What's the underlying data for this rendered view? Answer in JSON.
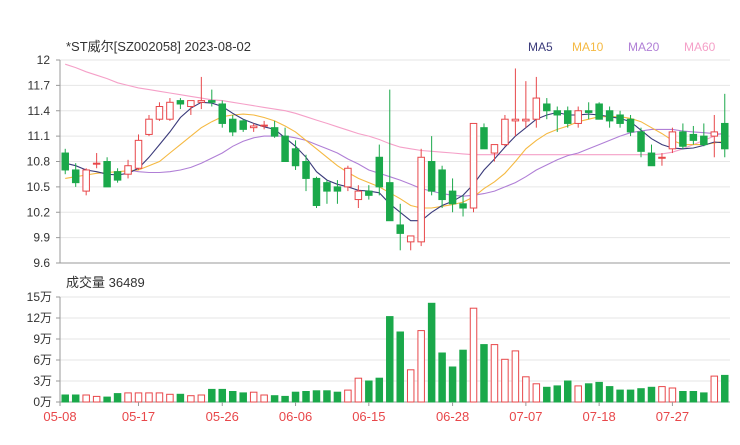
{
  "title": "*ST威尔[SZ002058] 2023-08-02",
  "legend": [
    {
      "label": "MA5",
      "color": "#3a3a7a"
    },
    {
      "label": "MA10",
      "color": "#f5b942"
    },
    {
      "label": "MA20",
      "color": "#b07fd6"
    },
    {
      "label": "MA60",
      "color": "#f5a0c8"
    }
  ],
  "colors": {
    "up": "#e8474a",
    "down": "#1aa84a",
    "grid": "#e6e6e6",
    "axis": "#999999",
    "text": "#333333",
    "date": "#e8474a"
  },
  "volume_label": "成交量 36489",
  "chart_data": [
    {
      "type": "candlestick",
      "ylim": [
        9.6,
        12.0
      ],
      "yticks": [
        "12",
        "11.7",
        "11.4",
        "11.1",
        "10.8",
        "10.5",
        "10.2",
        "9.9",
        "9.6"
      ],
      "ytick_values": [
        12.0,
        11.7,
        11.4,
        11.1,
        10.8,
        10.5,
        10.2,
        9.9,
        9.6
      ],
      "ohlc": [
        [
          10.9,
          10.95,
          10.65,
          10.7
        ],
        [
          10.7,
          10.78,
          10.5,
          10.55
        ],
        [
          10.45,
          10.72,
          10.4,
          10.7
        ],
        [
          10.78,
          10.9,
          10.72,
          10.78
        ],
        [
          10.8,
          10.85,
          10.5,
          10.5
        ],
        [
          10.68,
          10.72,
          10.55,
          10.58
        ],
        [
          10.65,
          10.82,
          10.6,
          10.75
        ],
        [
          10.72,
          11.12,
          10.7,
          11.05
        ],
        [
          11.12,
          11.35,
          11.1,
          11.3
        ],
        [
          11.3,
          11.5,
          11.28,
          11.45
        ],
        [
          11.3,
          11.55,
          11.28,
          11.5
        ],
        [
          11.52,
          11.55,
          11.42,
          11.48
        ],
        [
          11.45,
          11.5,
          11.35,
          11.52
        ],
        [
          11.5,
          11.8,
          11.42,
          11.52
        ],
        [
          11.52,
          11.65,
          11.45,
          11.5
        ],
        [
          11.48,
          11.52,
          11.2,
          11.25
        ],
        [
          11.3,
          11.35,
          11.1,
          11.15
        ],
        [
          11.28,
          11.3,
          11.15,
          11.18
        ],
        [
          11.2,
          11.25,
          11.15,
          11.22
        ],
        [
          11.22,
          11.28,
          11.18,
          11.23
        ],
        [
          11.2,
          11.28,
          11.08,
          11.1
        ],
        [
          11.1,
          11.2,
          10.85,
          10.8
        ],
        [
          10.95,
          11.05,
          10.7,
          10.75
        ],
        [
          10.8,
          10.88,
          10.45,
          10.6
        ],
        [
          10.6,
          10.62,
          10.25,
          10.28
        ],
        [
          10.55,
          10.58,
          10.3,
          10.45
        ],
        [
          10.5,
          10.58,
          10.3,
          10.45
        ],
        [
          10.5,
          10.75,
          10.45,
          10.72
        ],
        [
          10.35,
          10.52,
          10.25,
          10.45
        ],
        [
          10.45,
          10.52,
          10.35,
          10.4
        ],
        [
          10.85,
          11.0,
          10.4,
          10.5
        ],
        [
          10.55,
          11.65,
          10.5,
          10.1
        ],
        [
          10.05,
          10.3,
          9.75,
          9.95
        ],
        [
          9.85,
          9.92,
          9.75,
          9.92
        ],
        [
          9.85,
          10.95,
          9.8,
          10.85
        ],
        [
          10.8,
          11.1,
          10.4,
          10.45
        ],
        [
          10.7,
          10.75,
          10.25,
          10.35
        ],
        [
          10.45,
          10.6,
          10.2,
          10.3
        ],
        [
          10.3,
          10.4,
          10.15,
          10.25
        ],
        [
          10.25,
          11.25,
          10.2,
          11.25
        ],
        [
          11.2,
          11.25,
          10.95,
          10.95
        ],
        [
          10.9,
          11.0,
          10.8,
          11.0
        ],
        [
          11.0,
          11.35,
          10.98,
          11.3
        ],
        [
          11.28,
          11.9,
          11.1,
          11.3
        ],
        [
          11.28,
          11.75,
          11.2,
          11.3
        ],
        [
          11.3,
          11.8,
          11.2,
          11.55
        ],
        [
          11.48,
          11.55,
          11.3,
          11.4
        ],
        [
          11.4,
          11.45,
          11.15,
          11.35
        ],
        [
          11.4,
          11.45,
          11.2,
          11.25
        ],
        [
          11.25,
          11.45,
          11.2,
          11.4
        ],
        [
          11.4,
          11.5,
          11.3,
          11.38
        ],
        [
          11.48,
          11.5,
          11.3,
          11.3
        ],
        [
          11.4,
          11.45,
          11.2,
          11.28
        ],
        [
          11.35,
          11.4,
          11.2,
          11.25
        ],
        [
          11.3,
          11.35,
          11.1,
          11.15
        ],
        [
          11.15,
          11.2,
          10.85,
          10.92
        ],
        [
          10.9,
          11.0,
          10.75,
          10.75
        ],
        [
          10.85,
          10.9,
          10.75,
          10.85
        ],
        [
          10.95,
          11.2,
          10.9,
          11.15
        ],
        [
          11.15,
          11.25,
          10.95,
          10.98
        ],
        [
          11.12,
          11.22,
          11.0,
          11.05
        ],
        [
          11.1,
          11.25,
          10.98,
          11.0
        ],
        [
          11.1,
          11.35,
          10.85,
          11.15
        ],
        [
          11.25,
          11.6,
          10.85,
          10.95
        ]
      ],
      "ma5": [
        10.78,
        10.75,
        10.7,
        10.68,
        10.65,
        10.64,
        10.66,
        10.72,
        10.85,
        11.0,
        11.15,
        11.32,
        11.43,
        11.5,
        11.49,
        11.45,
        11.37,
        11.3,
        11.25,
        11.21,
        11.18,
        11.08,
        10.98,
        10.85,
        10.68,
        10.58,
        10.53,
        10.5,
        10.46,
        10.45,
        10.43,
        10.3,
        10.2,
        10.1,
        10.1,
        10.2,
        10.28,
        10.33,
        10.4,
        10.53,
        10.7,
        10.83,
        10.97,
        11.1,
        11.2,
        11.3,
        11.35,
        11.38,
        11.35,
        11.35,
        11.36,
        11.35,
        11.33,
        11.31,
        11.27,
        11.17,
        11.07,
        11.0,
        10.96,
        10.95,
        10.96,
        10.99,
        11.03,
        11.02
      ],
      "ma10": [
        10.6,
        10.62,
        10.64,
        10.66,
        10.67,
        10.68,
        10.69,
        10.7,
        10.75,
        10.8,
        10.9,
        11.0,
        11.1,
        11.2,
        11.27,
        11.33,
        11.35,
        11.36,
        11.35,
        11.32,
        11.28,
        11.22,
        11.15,
        11.05,
        10.95,
        10.85,
        10.75,
        10.67,
        10.6,
        10.55,
        10.5,
        10.43,
        10.36,
        10.28,
        10.25,
        10.25,
        10.27,
        10.29,
        10.32,
        10.38,
        10.48,
        10.56,
        10.66,
        10.8,
        10.95,
        11.05,
        11.13,
        11.18,
        11.22,
        11.27,
        11.3,
        11.33,
        11.33,
        11.33,
        11.31,
        11.27,
        11.2,
        11.13,
        11.05,
        11.0,
        11.0,
        11.0,
        11.02,
        11.04
      ],
      "ma20": [
        null,
        null,
        null,
        null,
        null,
        null,
        10.7,
        10.68,
        10.67,
        10.67,
        10.68,
        10.7,
        10.73,
        10.78,
        10.84,
        10.9,
        10.98,
        11.04,
        11.08,
        11.1,
        11.1,
        11.1,
        11.08,
        11.05,
        11.0,
        10.95,
        10.9,
        10.83,
        10.77,
        10.7,
        10.66,
        10.62,
        10.58,
        10.53,
        10.48,
        10.45,
        10.42,
        10.4,
        10.39,
        10.4,
        10.42,
        10.45,
        10.5,
        10.55,
        10.62,
        10.7,
        10.76,
        10.82,
        10.87,
        10.9,
        10.95,
        11.0,
        11.05,
        11.1,
        11.14,
        11.16,
        11.18,
        11.18,
        11.18,
        11.16,
        11.15,
        11.14,
        11.13,
        11.12
      ],
      "ma60": [
        11.95,
        11.91,
        11.86,
        11.82,
        11.78,
        11.73,
        11.7,
        11.67,
        11.65,
        11.63,
        11.61,
        11.59,
        11.57,
        11.55,
        11.53,
        11.52,
        11.5,
        11.48,
        11.46,
        11.44,
        11.42,
        11.4,
        11.37,
        11.33,
        11.29,
        11.25,
        11.21,
        11.17,
        11.13,
        11.1,
        11.06,
        11.01,
        10.97,
        10.95,
        10.93,
        10.92,
        10.91,
        10.9,
        10.89,
        10.88,
        10.88,
        10.88,
        10.88,
        10.88,
        10.88,
        10.88,
        10.88,
        10.88,
        10.88,
        10.88,
        10.88,
        10.88,
        10.88,
        10.88,
        10.88,
        10.88,
        10.88,
        10.89,
        10.91,
        10.95,
        11.0,
        11.05,
        11.1,
        11.15
      ]
    },
    {
      "type": "bar",
      "ylim": [
        0,
        15
      ],
      "yticks": [
        "15万",
        "12万",
        "9万",
        "6万",
        "3万",
        "0万"
      ],
      "ytick_values": [
        15,
        12,
        9,
        6,
        3,
        0
      ],
      "values": [
        1.0,
        1.0,
        1.0,
        0.8,
        0.7,
        1.2,
        1.3,
        1.3,
        1.3,
        1.3,
        1.1,
        1.1,
        0.9,
        1.0,
        1.8,
        1.8,
        1.5,
        1.3,
        1.4,
        1.0,
        0.9,
        0.8,
        1.4,
        1.5,
        1.6,
        1.6,
        1.4,
        1.7,
        3.4,
        3.0,
        3.4,
        12.2,
        10.0,
        4.6,
        10.2,
        14.1,
        7.0,
        5.0,
        7.4,
        13.4,
        8.2,
        8.2,
        6.1,
        7.3,
        3.6,
        2.6,
        2.1,
        2.3,
        3.0,
        2.3,
        2.6,
        2.8,
        2.2,
        1.7,
        1.7,
        1.9,
        2.1,
        2.2,
        2.0,
        1.5,
        1.5,
        1.3,
        3.7,
        3.8
      ],
      "categories": [
        "05-08",
        "05-17",
        "05-26",
        "06-06",
        "06-15",
        "06-28",
        "07-07",
        "07-18",
        "07-27"
      ]
    }
  ]
}
